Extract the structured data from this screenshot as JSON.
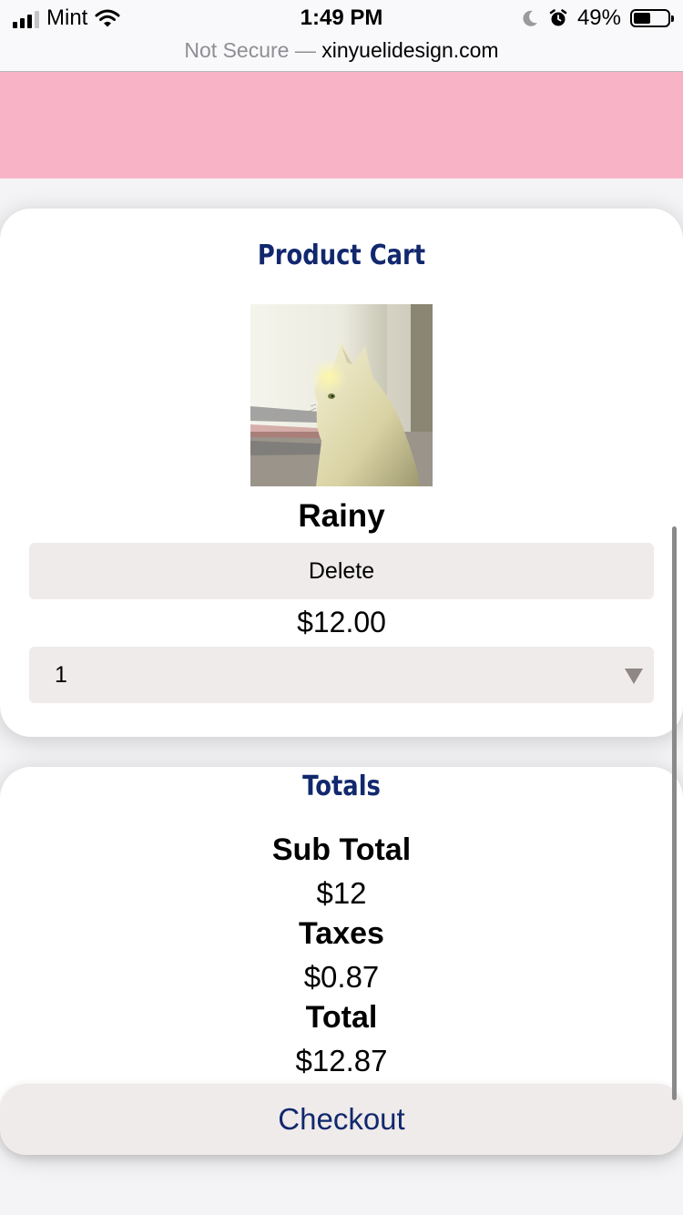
{
  "status_bar": {
    "carrier": "Mint",
    "time": "1:49 PM",
    "battery": "49%"
  },
  "url_bar": {
    "security": "Not Secure —",
    "domain": "xinyuelidesign.com"
  },
  "cart": {
    "title": "Product Cart",
    "item": {
      "name": "Rainy",
      "delete_label": "Delete",
      "price": "$12.00",
      "quantity": "1"
    }
  },
  "totals": {
    "title": "Totals",
    "subtotal_label": "Sub Total",
    "subtotal": "$12",
    "taxes_label": "Taxes",
    "taxes": "$0.87",
    "total_label": "Total",
    "total": "$12.87"
  },
  "checkout_label": "Checkout",
  "colors": {
    "accent": "#12286e",
    "header_pink": "#f8b4c6",
    "button_bg": "#efebea"
  }
}
